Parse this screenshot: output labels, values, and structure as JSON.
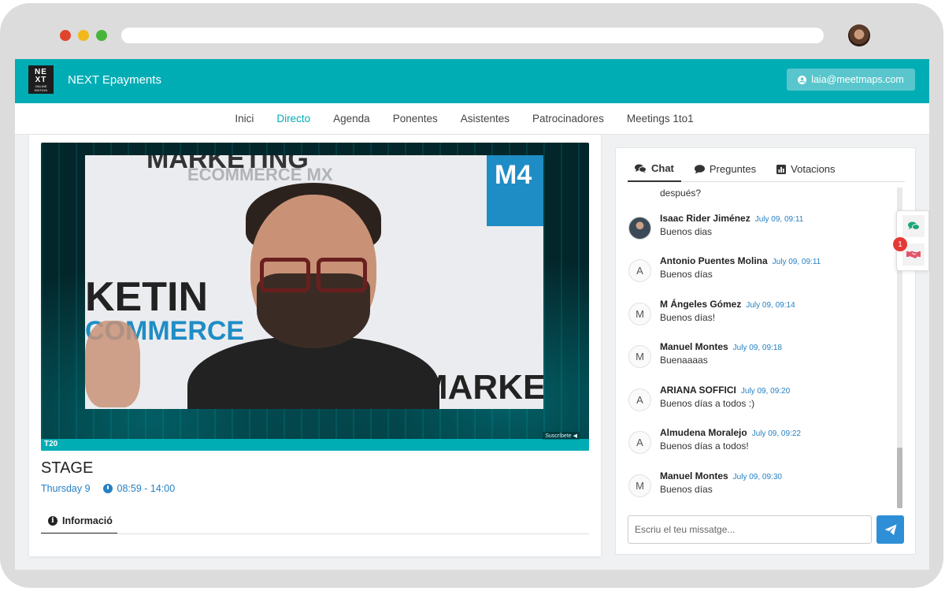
{
  "browser": {
    "traffic_lights": [
      "#e0452c",
      "#f1b81a",
      "#49b43c"
    ]
  },
  "header": {
    "logo_text": "NE XT",
    "logo_subtext": "ONLINE EDITION",
    "app_title": "NEXT Epayments",
    "user_email": "laia@meetmaps.com"
  },
  "nav": {
    "items": [
      {
        "label": "Inici",
        "active": false
      },
      {
        "label": "Directo",
        "active": true
      },
      {
        "label": "Agenda",
        "active": false
      },
      {
        "label": "Ponentes",
        "active": false
      },
      {
        "label": "Asistentes",
        "active": false
      },
      {
        "label": "Patrocinadores",
        "active": false
      },
      {
        "label": "Meetings 1to1",
        "active": false
      }
    ]
  },
  "video": {
    "tag": "T20",
    "subscribe": "Suscríbete ◀",
    "banner_words": [
      "MARKETING",
      "ECOMMERCE MX",
      "KETIN",
      "COMMERCE",
      "MARKETI"
    ],
    "logo_mark": "M4"
  },
  "stage": {
    "title": "STAGE",
    "date": "Thursday 9",
    "time": "08:59 - 14:00",
    "info_tab": "Informació"
  },
  "chat": {
    "tabs": [
      {
        "label": "Chat",
        "active": true,
        "icon": "comments-icon"
      },
      {
        "label": "Preguntes",
        "active": false,
        "icon": "speech-bubble-icon"
      },
      {
        "label": "Votacions",
        "active": false,
        "icon": "bar-chart-icon"
      }
    ],
    "truncated_text": "después?",
    "messages": [
      {
        "initial": "",
        "name": "Isaac Rider Jiménez",
        "time": "July 09, 09:11",
        "text": "Buenos dias",
        "photo": true
      },
      {
        "initial": "A",
        "name": "Antonio Puentes Molina",
        "time": "July 09, 09:11",
        "text": "Buenos días",
        "photo": false
      },
      {
        "initial": "M",
        "name": "M Ángeles Gómez",
        "time": "July 09, 09:14",
        "text": "Buenos días!",
        "photo": false
      },
      {
        "initial": "M",
        "name": "Manuel Montes",
        "time": "July 09, 09:18",
        "text": "Buenaaaas",
        "photo": false
      },
      {
        "initial": "A",
        "name": "ARIANA SOFFICI",
        "time": "July 09, 09:20",
        "text": "Buenos días a todos :)",
        "photo": false
      },
      {
        "initial": "A",
        "name": "Almudena Moralejo",
        "time": "July 09, 09:22",
        "text": "Buenos días a todos!",
        "photo": false
      },
      {
        "initial": "M",
        "name": "Manuel Montes",
        "time": "July 09, 09:30",
        "text": "Buenos días",
        "photo": false
      }
    ],
    "input_placeholder": "Escriu el teu missatge..."
  },
  "float_panel": {
    "badge": "1"
  },
  "colors": {
    "primary": "#00adb5",
    "link": "#2680c2",
    "send": "#2e8fd6",
    "badge": "#e53935"
  }
}
